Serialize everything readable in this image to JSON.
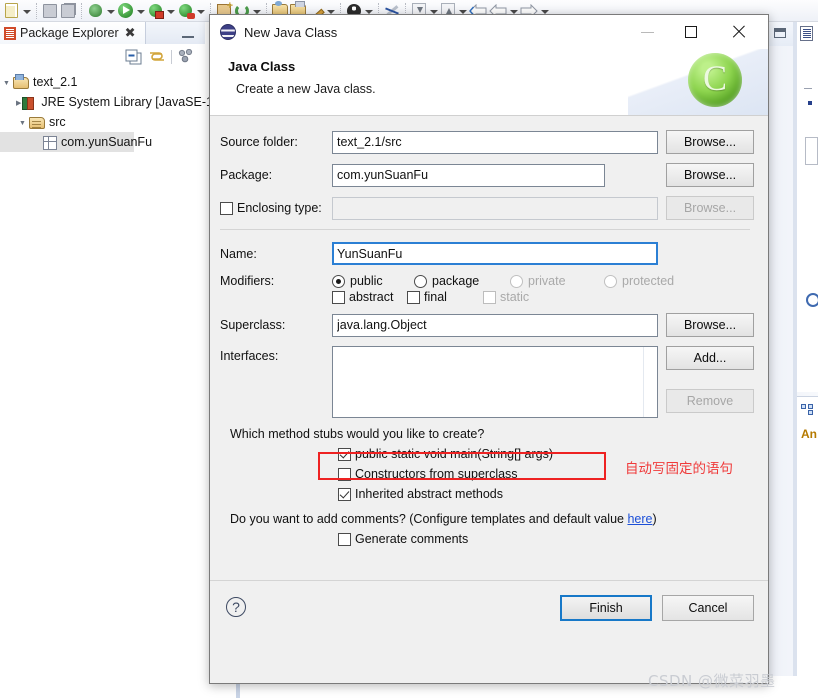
{
  "ide": {
    "toolbar": {
      "items": [
        {
          "icon": "new-file-icon",
          "dropdown": true
        },
        {
          "icon": "save-icon",
          "dropdown": false
        },
        {
          "icon": "save-all-icon",
          "dropdown": false
        },
        {
          "icon": "debug-icon",
          "dropdown": true
        },
        {
          "icon": "run-icon",
          "dropdown": true
        },
        {
          "icon": "run-as-icon",
          "dropdown": true
        },
        {
          "icon": "coverage-icon",
          "dropdown": true
        },
        {
          "icon": "new-package-icon",
          "dropdown": false
        },
        {
          "icon": "refresh-icon",
          "dropdown": true
        },
        {
          "icon": "open-type-icon",
          "dropdown": false
        },
        {
          "icon": "open-resource-icon",
          "dropdown": false
        },
        {
          "icon": "annotation-icon",
          "dropdown": true
        },
        {
          "icon": "user-icon",
          "dropdown": true
        },
        {
          "icon": "no-edit-icon",
          "dropdown": false
        },
        {
          "icon": "next-annotation-icon",
          "dropdown": true
        },
        {
          "icon": "previous-annotation-icon",
          "dropdown": true
        },
        {
          "icon": "back-icon",
          "dropdown": false
        },
        {
          "icon": "back-history-icon",
          "dropdown": true
        },
        {
          "icon": "forward-icon",
          "dropdown": true
        }
      ]
    },
    "package_explorer": {
      "tab_label": "Package Explorer",
      "close_glyph": "✖",
      "view_actions": [
        "collapse-all-icon",
        "link-with-editor-icon",
        "view-menu-icon"
      ],
      "tree": [
        {
          "label": "text_2.1",
          "icon": "project-icon",
          "twisty": "expanded",
          "indent": 0
        },
        {
          "label": "JRE System Library [JavaSE-1",
          "icon": "jre-library-icon",
          "twisty": "collapsed",
          "indent": 1
        },
        {
          "label": "src",
          "icon": "source-folder-icon",
          "twisty": "expanded",
          "indent": 1
        },
        {
          "label": "com.yunSuanFu",
          "icon": "package-icon",
          "twisty": "none",
          "indent": 2,
          "selected": true
        }
      ]
    },
    "right_panel": {
      "outline_label": "An"
    }
  },
  "dialog": {
    "title": "New Java Class",
    "window_buttons": {
      "minimize": "minimize-icon",
      "maximize": "maximize-icon",
      "close": "close-icon"
    },
    "header": {
      "heading": "Java Class",
      "description": "Create a new Java class.",
      "logo_letter": "C"
    },
    "fields": {
      "source_folder": {
        "label": "Source folder:",
        "value": "text_2.1/src",
        "button": "Browse..."
      },
      "package": {
        "label": "Package:",
        "value": "com.yunSuanFu",
        "button": "Browse..."
      },
      "enclosing_type": {
        "label": "Enclosing type:",
        "value": "",
        "button": "Browse...",
        "checked": false,
        "enabled": false
      },
      "name": {
        "label": "Name:",
        "value": "YunSuanFu",
        "focused": true
      },
      "modifiers": {
        "label": "Modifiers:",
        "radios": [
          {
            "label": "public",
            "selected": true,
            "enabled": true
          },
          {
            "label": "package",
            "selected": false,
            "enabled": true
          },
          {
            "label": "private",
            "selected": false,
            "enabled": false
          },
          {
            "label": "protected",
            "selected": false,
            "enabled": false
          }
        ],
        "checks": [
          {
            "label": "abstract",
            "checked": false,
            "enabled": true
          },
          {
            "label": "final",
            "checked": false,
            "enabled": true
          },
          {
            "label": "static",
            "checked": false,
            "enabled": false
          }
        ]
      },
      "superclass": {
        "label": "Superclass:",
        "value": "java.lang.Object",
        "button": "Browse..."
      },
      "interfaces": {
        "label": "Interfaces:",
        "value": "",
        "add_button": "Add...",
        "remove_button": "Remove"
      }
    },
    "stubs": {
      "question": "Which method stubs would you like to create?",
      "options": [
        {
          "label": "public static void main(String[] args)",
          "checked": true,
          "highlighted": true
        },
        {
          "label": "Constructors from superclass",
          "checked": false,
          "highlighted": false
        },
        {
          "label": "Inherited abstract methods",
          "checked": true,
          "highlighted": false
        }
      ]
    },
    "comments": {
      "question_prefix": "Do you want to add comments? (Configure templates and default value ",
      "link": "here",
      "question_suffix": ")",
      "option": {
        "label": "Generate comments",
        "checked": false
      }
    },
    "footer": {
      "help_glyph": "?",
      "finish": "Finish",
      "cancel": "Cancel"
    }
  },
  "annotation": {
    "note_text": "自动写固定的语句",
    "note_color": "#ef3b3b",
    "box_color": "#ee2222"
  },
  "watermark": "CSDN @微菜羽墨"
}
